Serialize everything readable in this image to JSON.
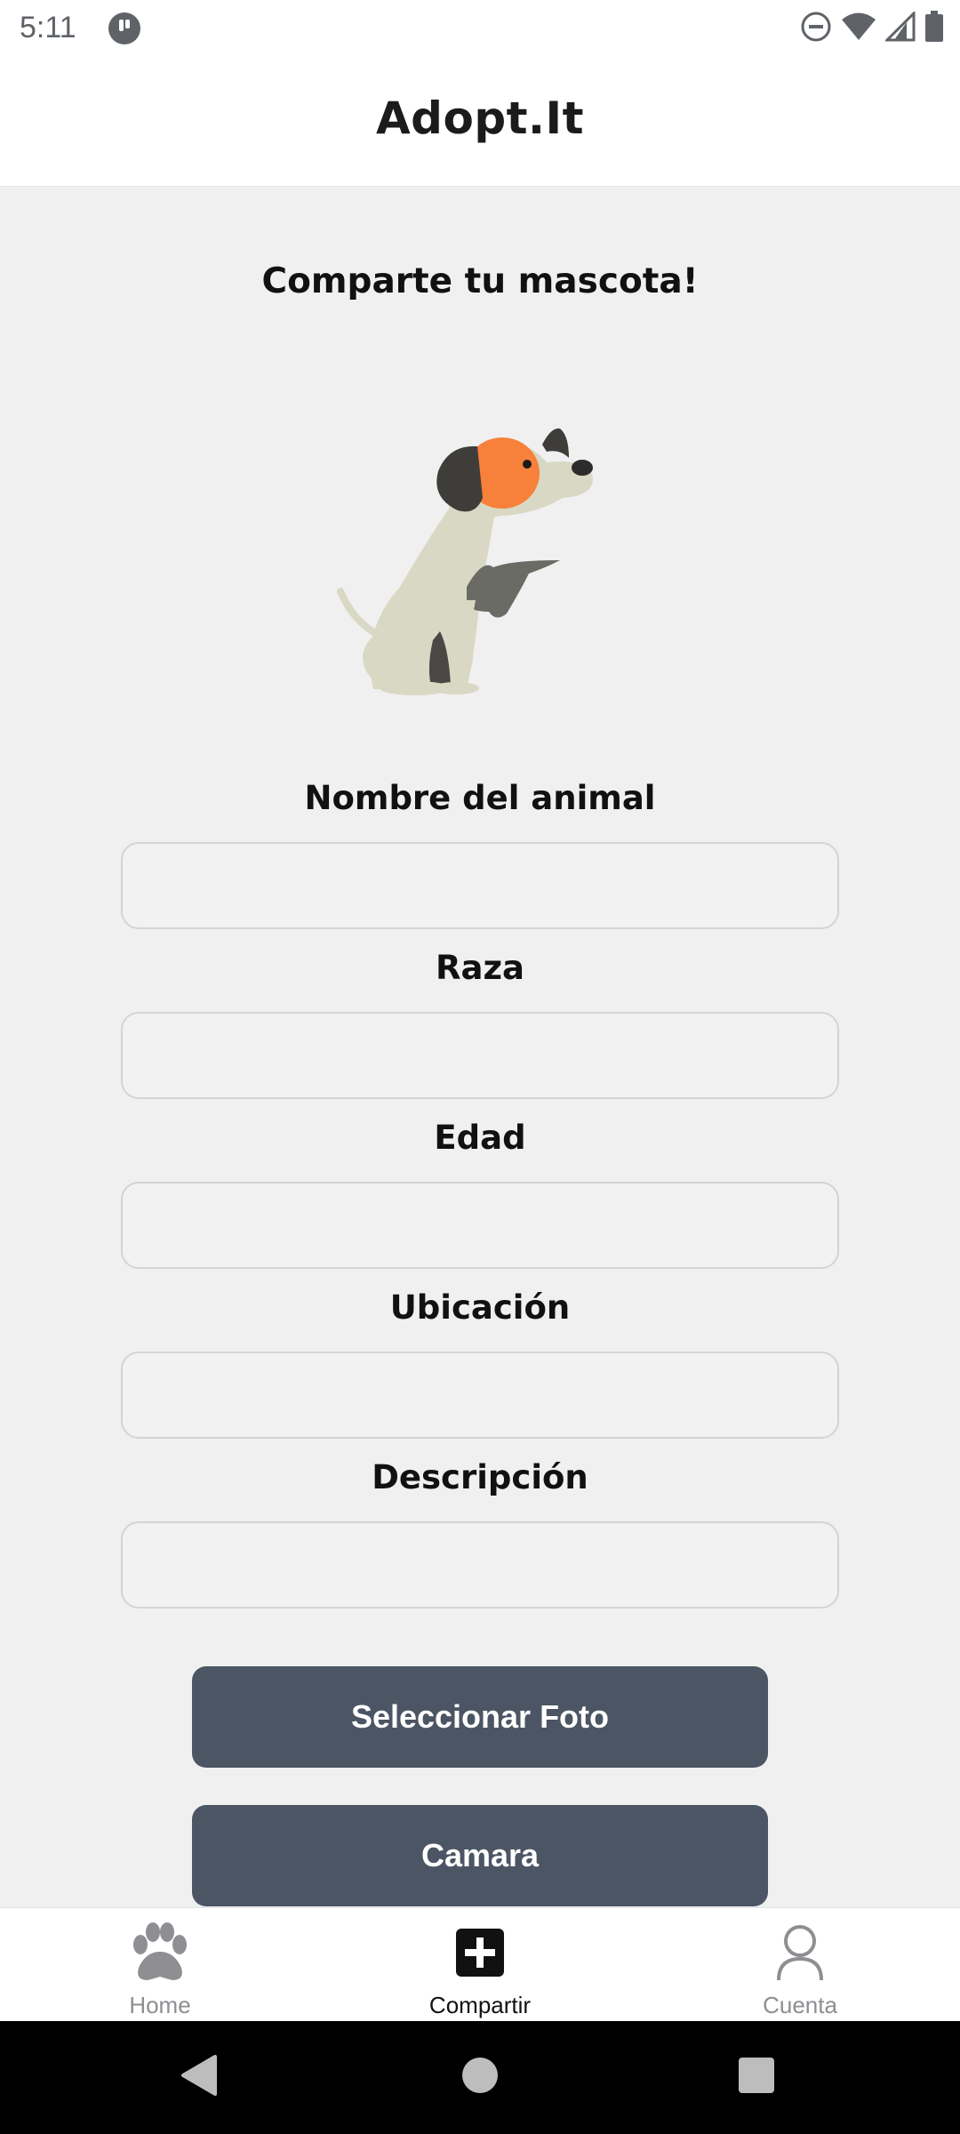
{
  "status_bar": {
    "time": "5:11",
    "icons": [
      "app-notification-icon",
      "do-not-disturb-icon",
      "wifi-icon",
      "cell-signal-icon",
      "battery-icon"
    ]
  },
  "header": {
    "title": "Adopt.It"
  },
  "main": {
    "heading": "Comparte tu mascota!",
    "illustration": "dog-illustration",
    "fields": [
      {
        "label": "Nombre del animal",
        "value": "",
        "placeholder": ""
      },
      {
        "label": "Raza",
        "value": "",
        "placeholder": ""
      },
      {
        "label": "Edad",
        "value": "",
        "placeholder": ""
      },
      {
        "label": "Ubicación",
        "value": "",
        "placeholder": ""
      },
      {
        "label": "Descripción",
        "value": "",
        "placeholder": ""
      }
    ],
    "buttons": {
      "select_photo": "Seleccionar Foto",
      "camera": "Camara"
    }
  },
  "bottom_nav": {
    "items": [
      {
        "label": "Home",
        "icon": "paw-icon",
        "active": false
      },
      {
        "label": "Compartir",
        "icon": "plus-square-icon",
        "active": true
      },
      {
        "label": "Cuenta",
        "icon": "user-icon",
        "active": false
      }
    ]
  },
  "colors": {
    "button_bg": "#4b5563",
    "page_bg": "#f0f0f0",
    "dog_accent": "#f7813a",
    "inactive_nav": "#8e8e93"
  }
}
